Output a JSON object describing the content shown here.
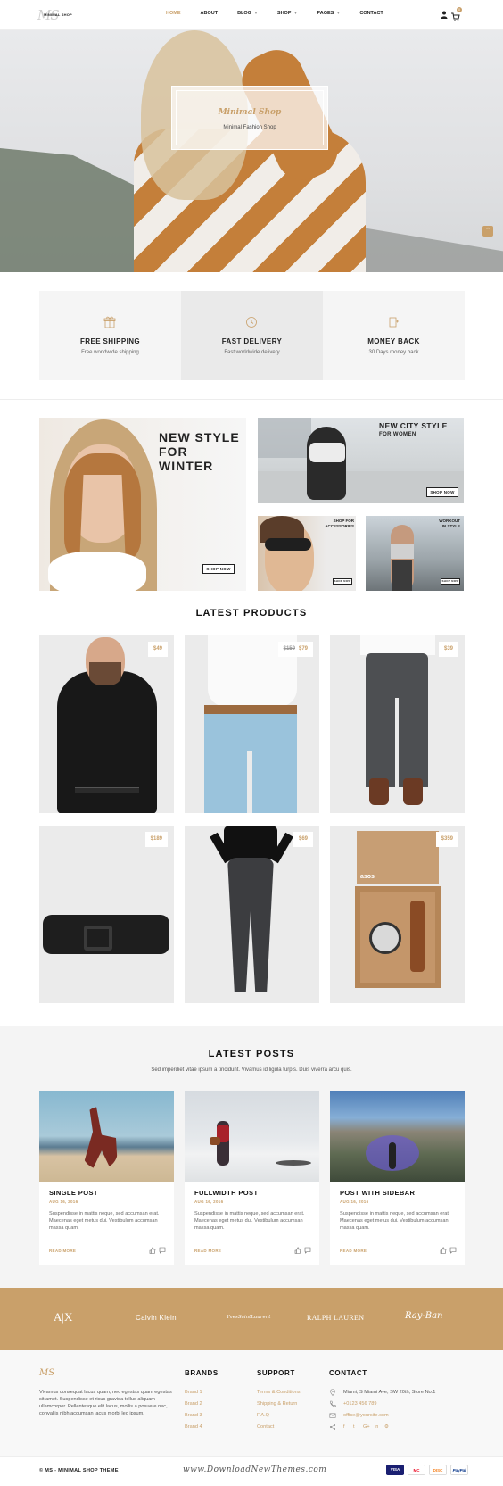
{
  "header": {
    "logo_text": "MINIMAL SHOP",
    "logo_mark": "MS",
    "nav": [
      {
        "label": "HOME",
        "active": true,
        "has_caret": false
      },
      {
        "label": "ABOUT",
        "active": false,
        "has_caret": false
      },
      {
        "label": "BLOG",
        "active": false,
        "has_caret": true
      },
      {
        "label": "SHOP",
        "active": false,
        "has_caret": true
      },
      {
        "label": "PAGES",
        "active": false,
        "has_caret": true
      },
      {
        "label": "CONTACT",
        "active": false,
        "has_caret": false
      }
    ],
    "cart_count": "0"
  },
  "hero": {
    "title": "Minimal Shop",
    "subtitle": "Minimal Fashion Shop"
  },
  "features": [
    {
      "title": "FREE SHIPPING",
      "subtitle": "Free worldwide shipping",
      "icon": "gift-icon"
    },
    {
      "title": "FAST DELIVERY",
      "subtitle": "Fast worldwide delivery",
      "icon": "clock-icon"
    },
    {
      "title": "MONEY BACK",
      "subtitle": "30 Days money back",
      "icon": "money-icon"
    }
  ],
  "banners": {
    "winter": {
      "title_line1": "NEW STYLE",
      "title_line2": "FOR",
      "title_line3": "WINTER",
      "button": "SHOP NOW"
    },
    "city": {
      "title": "NEW CITY STYLE",
      "subtitle": "FOR WOMEN",
      "button": "SHOP NOW"
    },
    "accessories": {
      "line1": "SHOP FOR",
      "line2": "ACCESSORIES",
      "button": "SHOP NOW"
    },
    "workout": {
      "line1": "WORKOUT",
      "line2": "IN STYLE",
      "button": "SHOP NOW"
    }
  },
  "latest_products": {
    "title": "LATEST PRODUCTS",
    "items": [
      {
        "price": "$49",
        "old_price": ""
      },
      {
        "price": "$79",
        "old_price": "$159"
      },
      {
        "price": "$39",
        "old_price": ""
      },
      {
        "price": "$189",
        "old_price": ""
      },
      {
        "price": "$69",
        "old_price": ""
      },
      {
        "price": "$359",
        "old_price": ""
      }
    ],
    "box_brand": "asos"
  },
  "latest_posts": {
    "title": "LATEST POSTS",
    "subtitle": "Sed imperdiet vitae ipsum a tincidunt. Vivamus id ligula turpis. Duis viverra arcu quis.",
    "posts": [
      {
        "title": "SINGLE POST",
        "date": "AUG 16, 2016",
        "text": "Suspendisse in mattis neque, sed accumsan erat. Maecenas eget metus dui. Vestibulum accumsan massa quam.",
        "read_more": "READ MORE"
      },
      {
        "title": "FULLWIDTH POST",
        "date": "AUG 16, 2016",
        "text": "Suspendisse in mattis neque, sed accumsan erat. Maecenas eget metus dui. Vestibulum accumsan massa quam.",
        "read_more": "READ MORE"
      },
      {
        "title": "POST WITH SIDEBAR",
        "date": "AUG 16, 2016",
        "text": "Suspendisse in mattis neque, sed accumsan erat. Maecenas eget metus dui. Vestibulum accumsan massa quam.",
        "read_more": "READ MORE"
      }
    ]
  },
  "brands": [
    "A|X",
    "Calvin Klein",
    "YvesSaintLaurent",
    "RALPH LAUREN",
    "Ray-Ban"
  ],
  "footer": {
    "logo_mark": "MS",
    "about": "Vivamus consequat lacus quam, nec egestas quam egestas sit amet. Suspendisse et risus gravida tellus aliquam ullamcorper. Pellentesque elit lacus, mollis a posuere nec, convallis nibh accumsan lacus morbi leo ipsum.",
    "brands_title": "BRANDS",
    "brands_links": [
      "Brand 1",
      "Brand 2",
      "Brand 3",
      "Brand 4"
    ],
    "support_title": "SUPPORT",
    "support_links": [
      "Terms & Conditions",
      "Shipping & Return",
      "F.A.Q",
      "Contact"
    ],
    "contact_title": "CONTACT",
    "address": "Miami, S Miami Ave, SW 20th, Store No.1",
    "phone": "+0123 456 789",
    "email": "office@yoursite.com",
    "social": [
      "f",
      "t",
      "G+",
      "in",
      "⚙"
    ]
  },
  "bottom": {
    "copyright": "© MS - MINIMAL SHOP THEME",
    "watermark": "www.DownloadNewThemes.com",
    "cards": [
      "VISA",
      "MC",
      "DISC",
      "PayPal"
    ]
  },
  "colors": {
    "accent": "#c9a06a",
    "dark": "#222222",
    "light_bg": "#f4f4f4"
  }
}
